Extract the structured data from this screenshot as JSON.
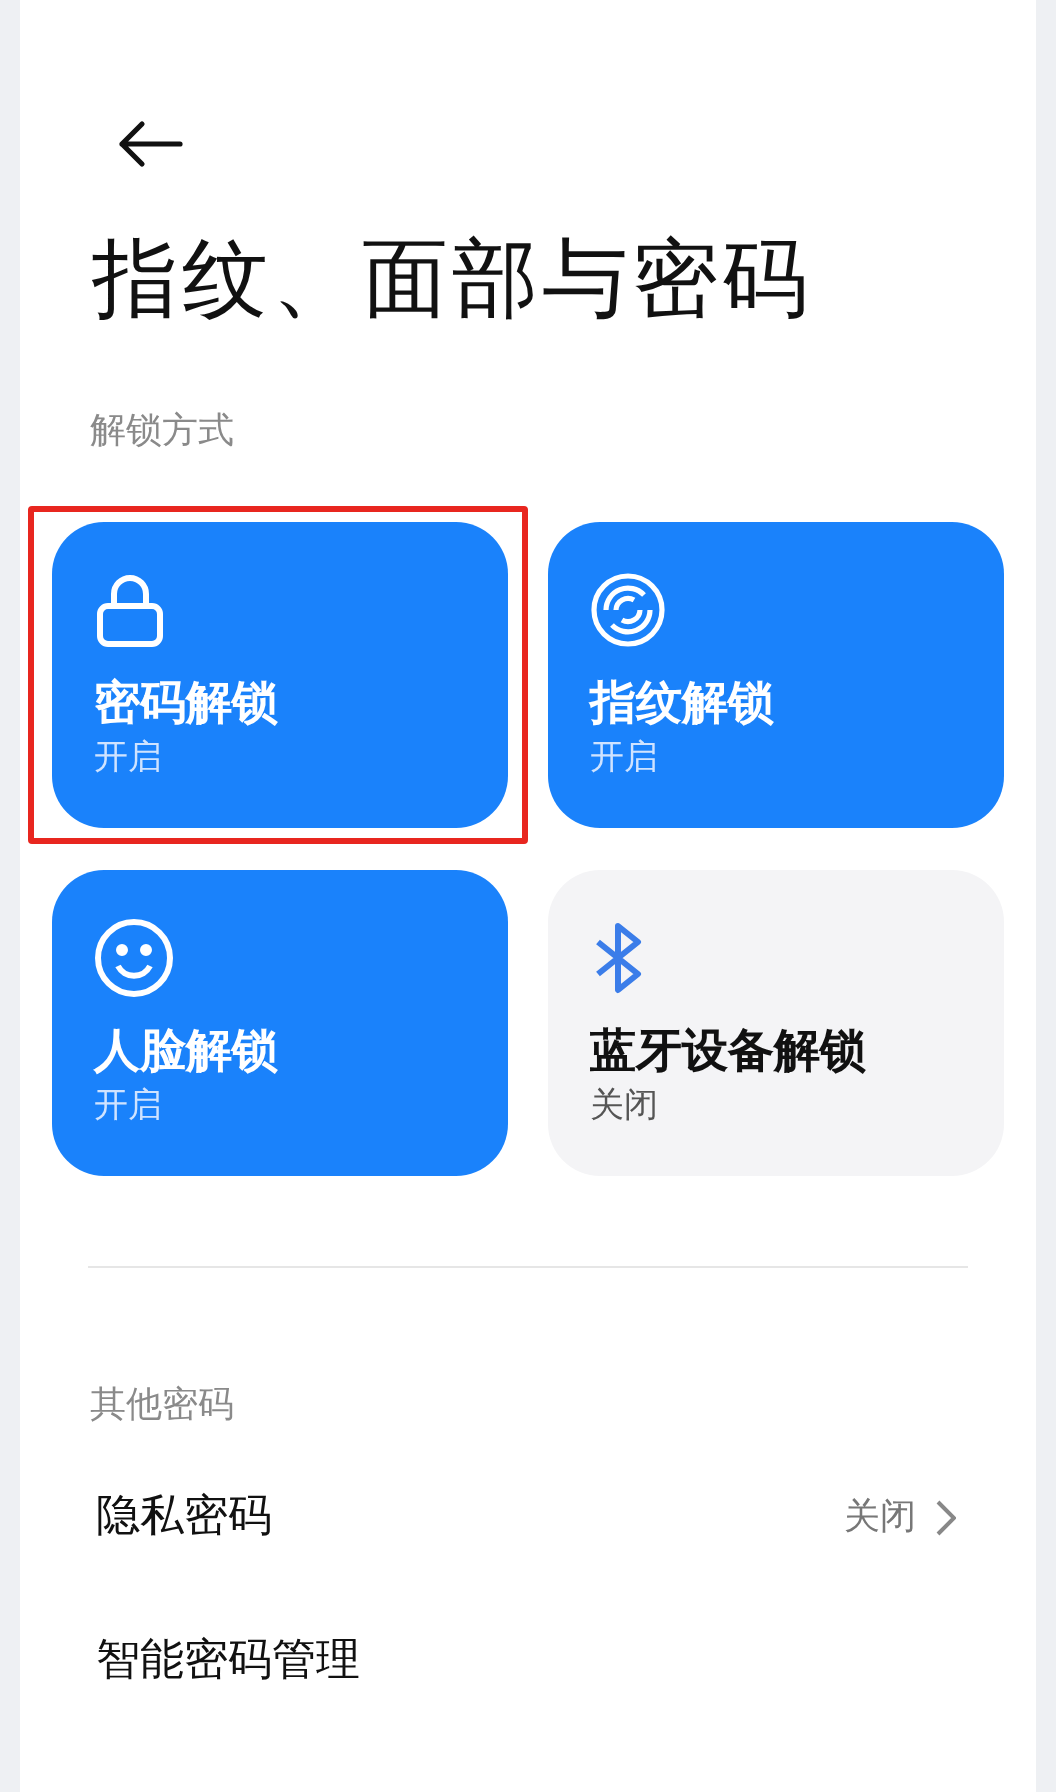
{
  "title": "指纹、面部与密码",
  "unlock_section": {
    "label": "解锁方式",
    "cards": [
      {
        "kind": "lock",
        "title": "密码解锁",
        "status": "开启",
        "on": true,
        "highlighted": true
      },
      {
        "kind": "fingerprint",
        "title": "指纹解锁",
        "status": "开启",
        "on": true,
        "highlighted": false
      },
      {
        "kind": "face",
        "title": "人脸解锁",
        "status": "开启",
        "on": true,
        "highlighted": false
      },
      {
        "kind": "bluetooth",
        "title": "蓝牙设备解锁",
        "status": "关闭",
        "on": false,
        "highlighted": false
      }
    ]
  },
  "other_section": {
    "label": "其他密码",
    "rows": [
      {
        "label": "隐私密码",
        "value": "关闭"
      },
      {
        "label": "智能密码管理"
      }
    ]
  }
}
